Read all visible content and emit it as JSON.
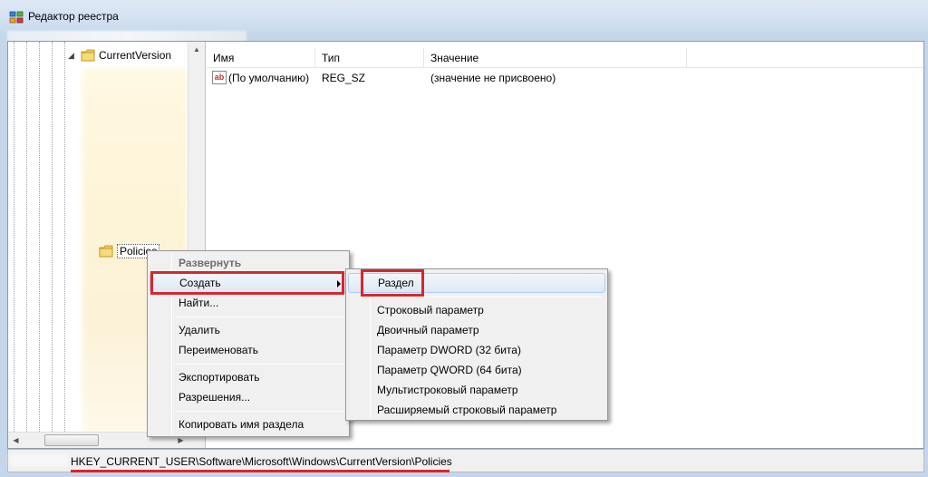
{
  "window": {
    "title": "Редактор реестра",
    "icon": "regedit-icon"
  },
  "tree": {
    "current_version": "CurrentVersion",
    "policies": "Policies"
  },
  "list": {
    "columns": [
      "Имя",
      "Тип",
      "Значение"
    ],
    "rows": [
      {
        "name": "(По умолчанию)",
        "type": "REG_SZ",
        "value": "(значение не присвоено)"
      }
    ]
  },
  "context_menu": {
    "expand": "Развернуть",
    "create": "Создать",
    "find": "Найти...",
    "delete": "Удалить",
    "rename": "Переименовать",
    "export": "Экспортировать",
    "permissions": "Разрешения...",
    "copy_key_name": "Копировать имя раздела"
  },
  "submenu": {
    "key": "Раздел",
    "string_value": "Строковый параметр",
    "binary_value": "Двоичный параметр",
    "dword_value": "Параметр DWORD (32 бита)",
    "qword_value": "Параметр QWORD (64 бита)",
    "multi_string_value": "Мультистроковый параметр",
    "expandable_string_value": "Расширяемый строковый параметр"
  },
  "statusbar": {
    "path": "HKEY_CURRENT_USER\\Software\\Microsoft\\Windows\\CurrentVersion\\Policies"
  },
  "colors": {
    "highlight": "#d9262e",
    "titlebar": "#c9daee"
  }
}
